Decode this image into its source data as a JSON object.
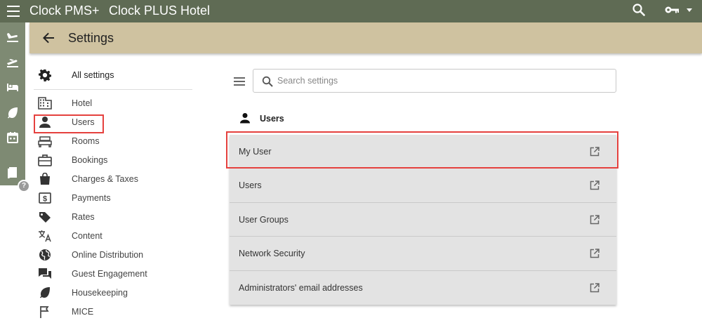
{
  "app": {
    "name": "Clock PMS+",
    "hotel": "Clock PLUS Hotel",
    "icons": {
      "menu": "hamburger-icon",
      "search": "search-icon",
      "account": "key-icon",
      "dropdown": "caret-down-icon"
    }
  },
  "left_rail": {
    "items": [
      {
        "icon": "arrivals-icon"
      },
      {
        "icon": "departures-icon"
      },
      {
        "icon": "rooms-bed-icon"
      },
      {
        "icon": "housekeeping-leaf-icon"
      },
      {
        "icon": "calendar-icon"
      },
      {
        "icon": "book-icon"
      }
    ],
    "help": "?"
  },
  "header": {
    "title": "Settings",
    "back_icon": "back-arrow-icon"
  },
  "nav": {
    "all": {
      "label": "All settings",
      "icon": "gear-icon"
    },
    "items": [
      {
        "label": "Hotel",
        "icon": "building-icon"
      },
      {
        "label": "Users",
        "icon": "person-icon",
        "highlighted": true
      },
      {
        "label": "Rooms",
        "icon": "bed-icon"
      },
      {
        "label": "Bookings",
        "icon": "briefcase-icon"
      },
      {
        "label": "Charges & Taxes",
        "icon": "shopping-bag-icon"
      },
      {
        "label": "Payments",
        "icon": "money-icon"
      },
      {
        "label": "Rates",
        "icon": "tag-icon"
      },
      {
        "label": "Content",
        "icon": "translate-icon"
      },
      {
        "label": "Online Distribution",
        "icon": "globe-icon"
      },
      {
        "label": "Guest Engagement",
        "icon": "chat-icon"
      },
      {
        "label": "Housekeeping",
        "icon": "leaf-icon"
      },
      {
        "label": "MICE",
        "icon": "flag-icon"
      }
    ],
    "highlight_color": "#e5413e"
  },
  "search": {
    "placeholder": "Search settings",
    "value": ""
  },
  "section": {
    "title": "Users",
    "icon": "person-icon",
    "rows": [
      {
        "label": "My User",
        "highlighted": true
      },
      {
        "label": "Users"
      },
      {
        "label": "User Groups"
      },
      {
        "label": "Network Security"
      },
      {
        "label": "Administrators' email addresses"
      }
    ],
    "row_icon": "open-external-icon"
  },
  "colors": {
    "topbar": "#5f6b54",
    "rail": "#7e8a73",
    "header": "#cfc2a0",
    "row_bg": "#e3e3e3",
    "highlight": "#e5413e"
  }
}
